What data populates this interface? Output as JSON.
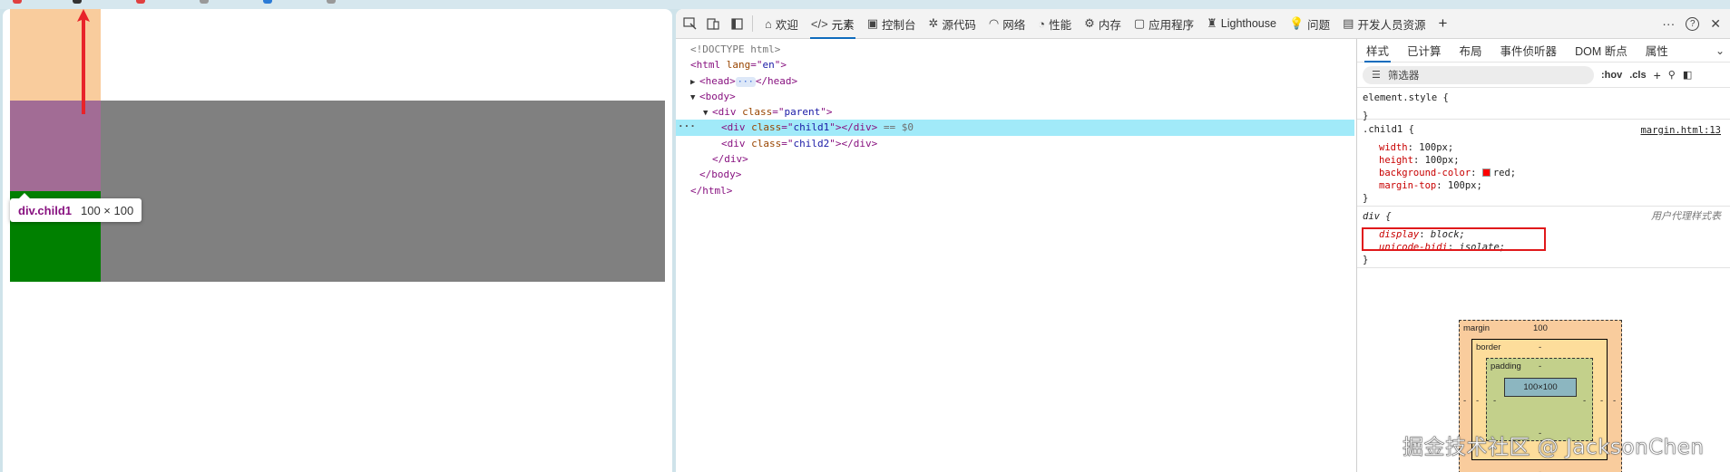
{
  "tooltip": {
    "tag": "div.child1",
    "size": "100 × 100"
  },
  "toolbar": {
    "tabs": [
      {
        "label": "欢迎",
        "icon": "home-icon"
      },
      {
        "label": "元素",
        "icon": "code-icon",
        "active": true
      },
      {
        "label": "控制台",
        "icon": "console-icon"
      },
      {
        "label": "源代码",
        "icon": "bug-icon"
      },
      {
        "label": "网络",
        "icon": "wifi-icon"
      },
      {
        "label": "性能",
        "icon": "performance-icon"
      },
      {
        "label": "内存",
        "icon": "gear-icon"
      },
      {
        "label": "应用程序",
        "icon": "application-icon"
      },
      {
        "label": "Lighthouse",
        "icon": "lighthouse-icon"
      },
      {
        "label": "问题",
        "icon": "lightbulb-icon"
      },
      {
        "label": "开发人员资源",
        "icon": "clipboard-icon"
      }
    ],
    "add_tab": "+",
    "more": "···",
    "help": "?",
    "close": "✕"
  },
  "dom": {
    "doctype": "<!DOCTYPE html>",
    "html_open_tag": "html",
    "html_lang_attr": "lang",
    "html_lang_val": "en",
    "head_open": "<head>",
    "head_close": "</head>",
    "head_badge": "···",
    "body_open": "<body>",
    "parent_tag": "div",
    "class_attr": "class",
    "parent_class": "parent",
    "child1_class": "child1",
    "child2_class": "child2",
    "selected_suffix": "== $0",
    "selected_dots": "···",
    "div_close": "</div>",
    "body_close": "</body>",
    "html_close": "</html>"
  },
  "styles": {
    "sub_tabs": [
      "样式",
      "已计算",
      "布局",
      "事件侦听器",
      "DOM 断点",
      "属性"
    ],
    "filter_placeholder": "筛选器",
    "hov": ":hov",
    "cls": ".cls",
    "element_style": "element.style {",
    "close_brace": "}",
    "child1_selector": ".child1 {",
    "child1_source": "margin.html:13",
    "child1_decls": [
      {
        "name": "width",
        "value": "100px;"
      },
      {
        "name": "height",
        "value": "100px;"
      },
      {
        "name": "background-color",
        "value": "red;",
        "swatch": "#ff0000"
      },
      {
        "name": "margin-top",
        "value": "100px;"
      }
    ],
    "div_selector": "div {",
    "div_source": "用户代理样式表",
    "div_decls": [
      {
        "name": "display",
        "value": "block;"
      },
      {
        "name": "unicode-bidi",
        "value": "isolate;"
      }
    ]
  },
  "boxmodel": {
    "margin_label": "margin",
    "margin_top": "100",
    "margin_side": "-",
    "margin_bottom": "-",
    "border_label": "border",
    "border_value": "-",
    "padding_label": "padding",
    "padding_value": "-",
    "content": "100×100"
  },
  "watermark": "掘金技术社区 @ JacksonChen",
  "colors": {
    "margin_highlight": "#f9cc9d",
    "child1_overlay": "#a26c95",
    "parent_bg": "#808080",
    "child2_bg": "#008000",
    "selected_row": "#a1eaf9",
    "annotation_red": "#e0191b"
  }
}
